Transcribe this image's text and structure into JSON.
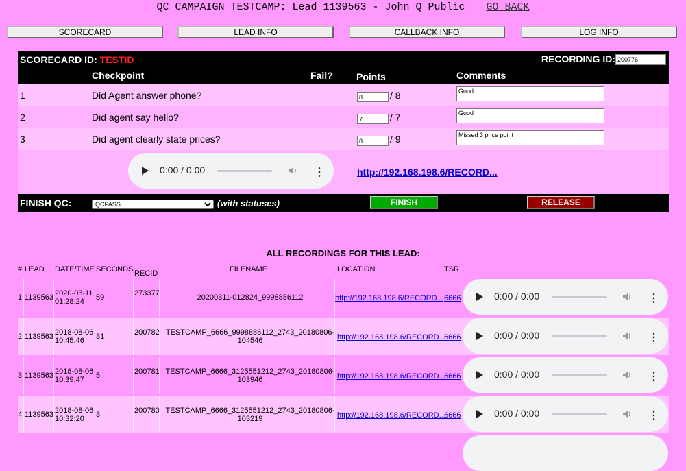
{
  "header": {
    "title": "QC CAMPAIGN TESTCAMP: Lead 1139563 - John Q Public",
    "go_back": "GO BACK"
  },
  "nav": [
    "SCORECARD",
    "LEAD INFO",
    "CALLBACK INFO",
    "LOG INFO"
  ],
  "scorecard": {
    "id_label": "SCORECARD ID:",
    "id_value": "TESTID",
    "recording_label": "RECORDING ID:",
    "recording_value": "200776",
    "col_checkpoint": "Checkpoint",
    "col_fail": "Fail?",
    "col_points": "Points",
    "col_comments": "Comments",
    "rows": [
      {
        "num": "1",
        "checkpoint": "Did Agent answer phone?",
        "points": "8",
        "max": "/ 8",
        "comment": "Good"
      },
      {
        "num": "2",
        "checkpoint": "Did agent say hello?",
        "points": "7",
        "max": "/ 7",
        "comment": "Good"
      },
      {
        "num": "3",
        "checkpoint": "Did agent clearly state prices?",
        "points": "8",
        "max": "/ 9",
        "comment": "Missed 3 price point"
      }
    ]
  },
  "player": {
    "time": "0:00 / 0:00"
  },
  "recording_link": "http://192.168.198.6/RECORD...",
  "finish": {
    "label": "FINISH QC:",
    "status": "QCPASS",
    "with_statuses": "(with statuses)",
    "finish_btn": "FINISH",
    "release_btn": "RELEASE"
  },
  "recordings": {
    "title": "ALL RECORDINGS FOR THIS LEAD:",
    "headers": {
      "num": "#",
      "lead": "LEAD",
      "datetime": "DATE/TIME",
      "seconds": "SECONDS",
      "recid": "RECID",
      "filename": "FILENAME",
      "location": "LOCATION",
      "tsr": "TSR"
    },
    "rows": [
      {
        "num": "1",
        "lead": "1139563",
        "date": "2020-03-11",
        "time": "01:28:24",
        "seconds": "59",
        "recid": "273377",
        "file1": "20200311-012824_9998886112",
        "file2": "",
        "location": "http://192.168.198.6/RECORD...",
        "tsr": "6666"
      },
      {
        "num": "2",
        "lead": "1139563",
        "date": "2018-08-06",
        "time": "10:45:46",
        "seconds": "31",
        "recid": "200782",
        "file1": "TESTCAMP_6666_9998886112_2743_20180806-",
        "file2": "104546",
        "location": "http://192.168.198.6/RECORD...",
        "tsr": "6666"
      },
      {
        "num": "3",
        "lead": "1139563",
        "date": "2018-08-06",
        "time": "10:39:47",
        "seconds": "5",
        "recid": "200781",
        "file1": "TESTCAMP_6666_3125551212_2743_20180806-",
        "file2": "103946",
        "location": "http://192.168.198.6/RECORD...",
        "tsr": "6666"
      },
      {
        "num": "4",
        "lead": "1139563",
        "date": "2018-08-06",
        "time": "10:32:20",
        "seconds": "3",
        "recid": "200780",
        "file1": "TESTCAMP_6666_3125551212_2743_20180806-",
        "file2": "103219",
        "location": "http://192.168.198.6/RECORD...",
        "tsr": "6666"
      }
    ]
  },
  "colors": {
    "page_bg": "#ff99ff",
    "row_light": "#ffc4ff",
    "finish_green": "#00aa00",
    "release_red": "#990000",
    "id_red": "#ff2222"
  }
}
